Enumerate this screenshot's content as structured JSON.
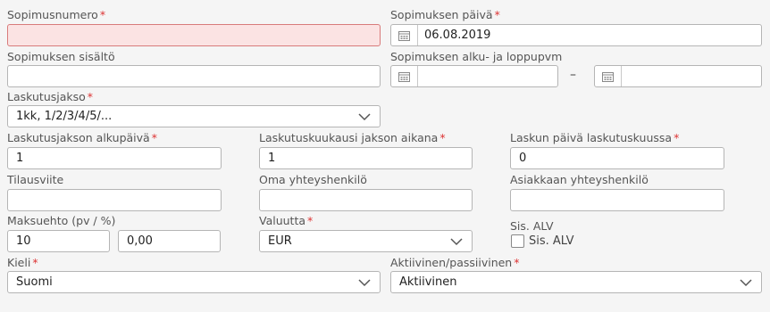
{
  "fields": {
    "sopimusnumero": {
      "label": "Sopimusnumero",
      "value": ""
    },
    "sopimuksen_paiva": {
      "label": "Sopimuksen päivä",
      "value": "06.08.2019"
    },
    "sopimuksen_sisalto": {
      "label": "Sopimuksen sisältö",
      "value": ""
    },
    "alku_loppu": {
      "label": "Sopimuksen alku- ja loppupvm",
      "start": "",
      "end": "",
      "separator": "–"
    },
    "laskutusjakso": {
      "label": "Laskutusjakso",
      "value": "1kk, 1/2/3/4/5/..."
    },
    "laskutusjakson_alkupaiva": {
      "label": "Laskutusjakson alkupäivä",
      "value": "1"
    },
    "laskutuskuukausi": {
      "label": "Laskutuskuukausi jakson aikana",
      "value": "1"
    },
    "laskun_paiva": {
      "label": "Laskun päivä laskutuskuussa",
      "value": "0"
    },
    "tilausviite": {
      "label": "Tilausviite",
      "value": ""
    },
    "oma_yhteyshenkilo": {
      "label": "Oma yhteyshenkilö",
      "value": ""
    },
    "asiakkaan_yhteyshenkilo": {
      "label": "Asiakkaan yhteyshenkilö",
      "value": ""
    },
    "maksuehto": {
      "label": "Maksuehto (pv / %)",
      "days": "10",
      "percent": "0,00"
    },
    "valuutta": {
      "label": "Valuutta",
      "value": "EUR"
    },
    "sis_alv": {
      "label": "Sis. ALV",
      "checkbox_label": "Sis. ALV",
      "checked": false
    },
    "kieli": {
      "label": "Kieli",
      "value": "Suomi"
    },
    "aktiivinen": {
      "label": "Aktiivinen/passiivinen",
      "value": "Aktiivinen"
    }
  },
  "required_marker": "*",
  "colors": {
    "required": "#dd3333",
    "error_bg": "#fbe3e3",
    "error_border": "#d87b7b"
  }
}
